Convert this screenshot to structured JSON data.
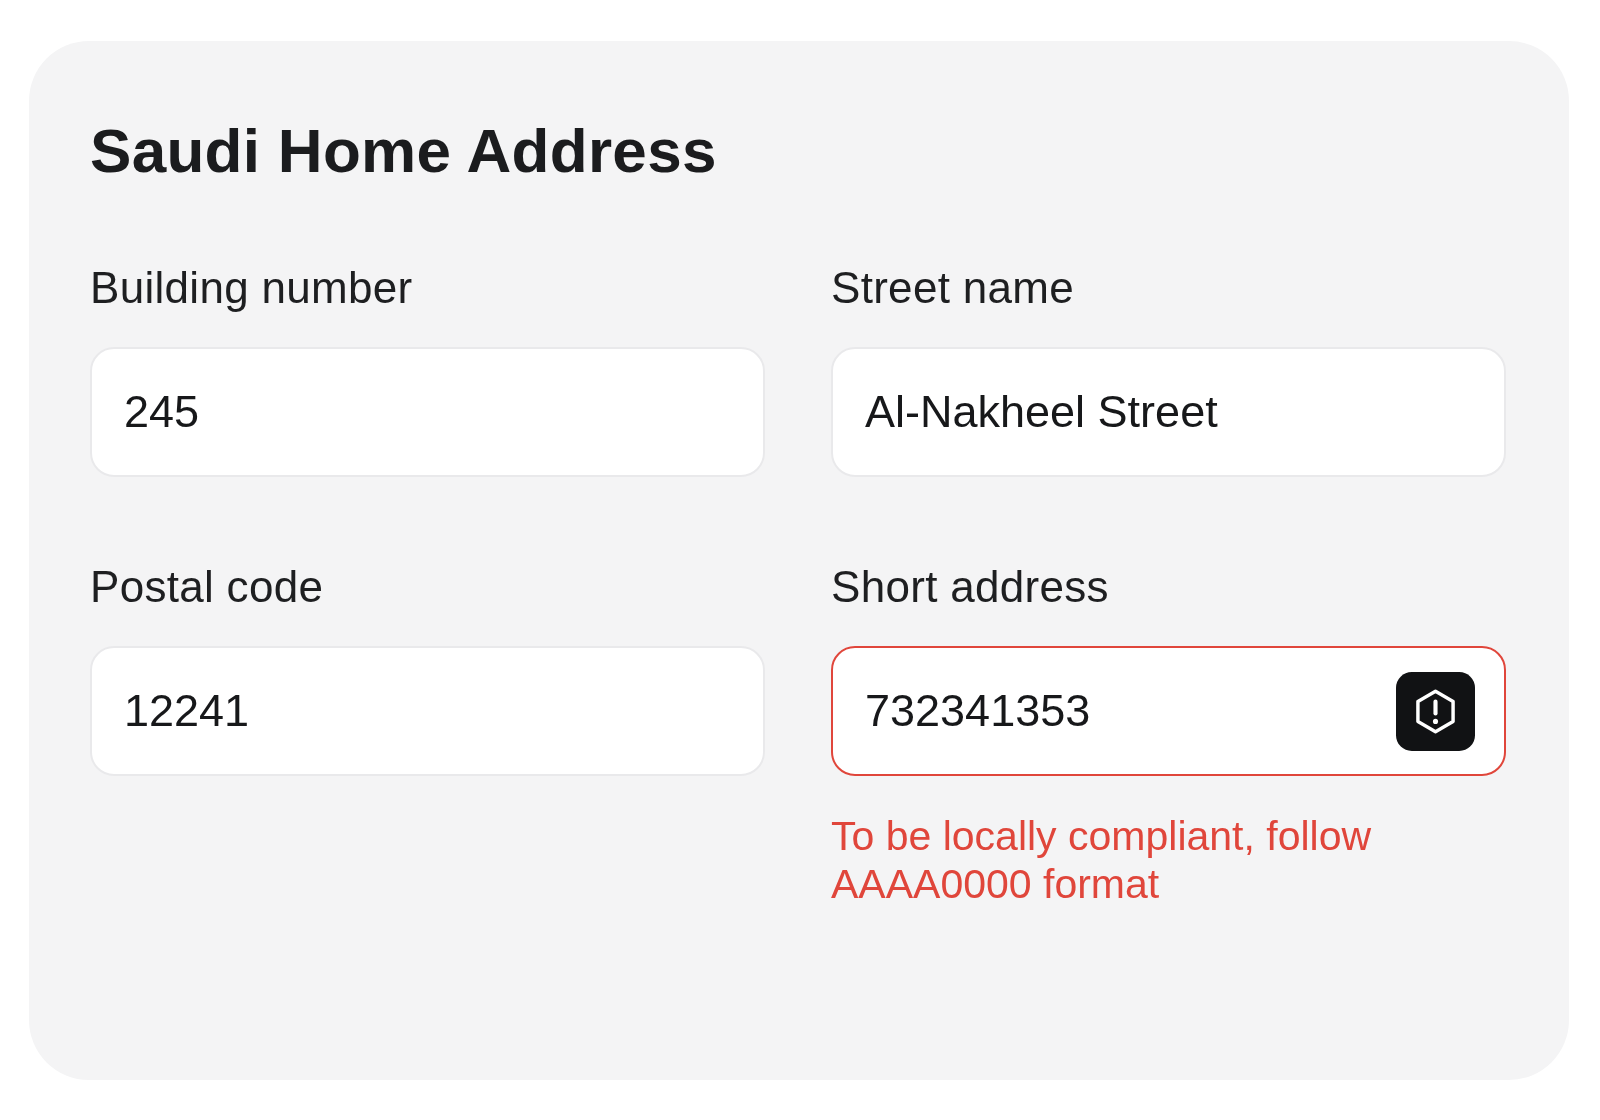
{
  "form": {
    "title": "Saudi Home Address",
    "fields": [
      {
        "label": "Building number",
        "value": "245",
        "invalid": false
      },
      {
        "label": "Street name",
        "value": "Al-Nakheel Street",
        "invalid": false
      },
      {
        "label": "Postal code",
        "value": "12241",
        "invalid": false
      },
      {
        "label": "Short address",
        "value": "732341353",
        "invalid": true,
        "error": "To be locally compliant, follow AAAA0000 format"
      }
    ]
  }
}
